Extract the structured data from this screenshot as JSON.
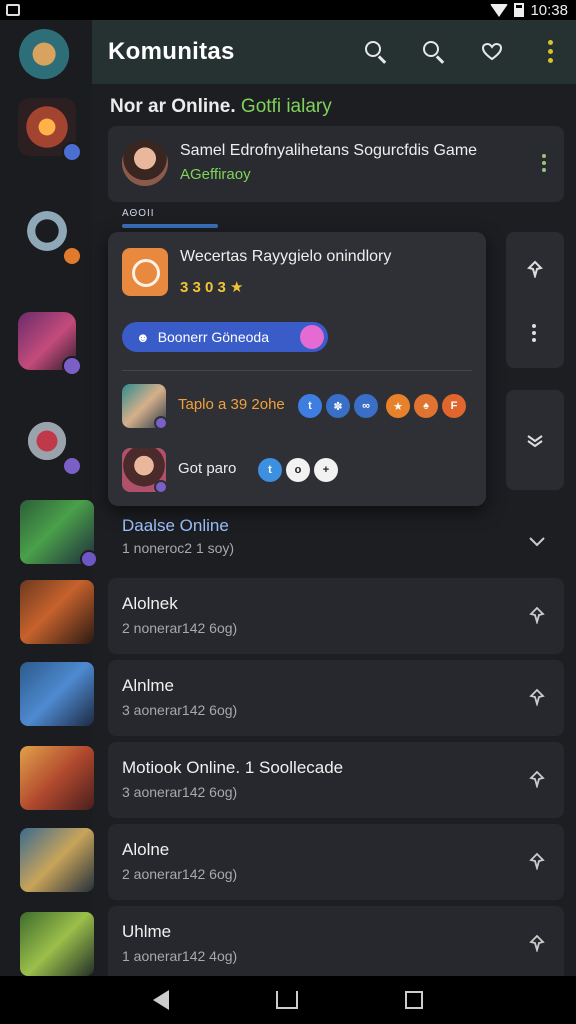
{
  "status_bar": {
    "time": "10:38"
  },
  "header": {
    "title": "Komunitas"
  },
  "section": {
    "title_main": "Nor ar Online. ",
    "title_accent": "Gotfi ialary"
  },
  "notification": {
    "title": "Samel Edrofnyalihetans Sogurcfdis Game",
    "subtitle": "AGeffiraoy"
  },
  "mini_label": "ΑΘΟΙΙ",
  "popup": {
    "title": "Wecertas Rayygielo onindlory",
    "rating": "3 3 0 3 ★",
    "button_label": "Boonerr Göneoda",
    "row1_label": "Taplo a 39 2ohe",
    "row2_label": "Got paro"
  },
  "list": [
    {
      "title": "Daalse Online",
      "sub": "1 noneroc2 1 soy)"
    },
    {
      "title": "Alolnek",
      "sub": "2 nonerar142 6og)"
    },
    {
      "title": "Alnlme",
      "sub": "3 aonerar142 6og)"
    },
    {
      "title": "Motiook Online. 1 Soollecade",
      "sub": "3 aonerar142 6og)"
    },
    {
      "title": "Alolne",
      "sub": "2 aonerar142 6og)"
    },
    {
      "title": "Uhlme",
      "sub": "1 aonerar142 4og)"
    }
  ],
  "colors": {
    "accent_green": "#7fd35a",
    "header_bg": "#263232",
    "button_blue": "#3a5cc9",
    "kebab_yellow": "#d7c32e"
  },
  "icons": [
    "search-icon",
    "heart-chat-icon",
    "more-vert-icon",
    "pin-icon",
    "chevron-down-icon",
    "back-icon",
    "home-icon",
    "recents-icon"
  ]
}
